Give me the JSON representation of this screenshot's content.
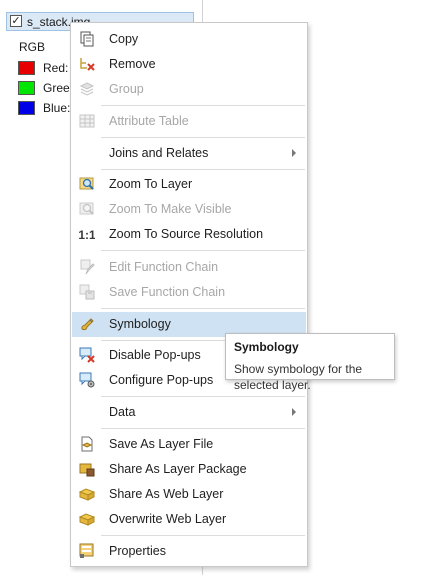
{
  "toc": {
    "layer_name": "s_stack.img",
    "checked": "✓",
    "renderer": "RGB",
    "bands": [
      {
        "label": "Red:",
        "color": "#e60000"
      },
      {
        "label": "Gree",
        "color": "#00e600"
      },
      {
        "label": "Blue:",
        "color": "#0000e6"
      }
    ]
  },
  "menu": {
    "items": [
      {
        "label": "Copy",
        "icon": "copy-icon",
        "enabled": true
      },
      {
        "label": "Remove",
        "icon": "remove-icon",
        "enabled": true
      },
      {
        "label": "Group",
        "icon": "group-icon",
        "enabled": false
      },
      {
        "label": "Attribute Table",
        "icon": "table-icon",
        "enabled": false
      },
      {
        "label": "Joins and Relates",
        "icon": "",
        "enabled": true,
        "submenu": true
      },
      {
        "label": "Zoom To Layer",
        "icon": "zoom-to-layer-icon",
        "enabled": true
      },
      {
        "label": "Zoom To Make Visible",
        "icon": "zoom-visible-icon",
        "enabled": false
      },
      {
        "label": "Zoom To Source Resolution",
        "icon": "one-to-one-icon",
        "icon_text": "1:1",
        "enabled": true
      },
      {
        "label": "Edit Function Chain",
        "icon": "edit-function-icon",
        "enabled": false
      },
      {
        "label": "Save Function Chain",
        "icon": "save-function-icon",
        "enabled": false
      },
      {
        "label": "Symbology",
        "icon": "symbology-icon",
        "enabled": true,
        "highlighted": true
      },
      {
        "label": "Disable Pop-ups",
        "icon": "disable-popups-icon",
        "enabled": true
      },
      {
        "label": "Configure Pop-ups",
        "icon": "configure-popups-icon",
        "enabled": true
      },
      {
        "label": "Data",
        "icon": "",
        "enabled": true,
        "submenu": true
      },
      {
        "label": "Save As Layer File",
        "icon": "layer-file-icon",
        "enabled": true
      },
      {
        "label": "Share As Layer Package",
        "icon": "layer-package-icon",
        "enabled": true
      },
      {
        "label": "Share As Web Layer",
        "icon": "web-layer-icon",
        "enabled": true
      },
      {
        "label": "Overwrite Web Layer",
        "icon": "overwrite-web-layer-icon",
        "enabled": true
      },
      {
        "label": "Properties",
        "icon": "properties-icon",
        "enabled": true
      }
    ]
  },
  "tooltip": {
    "title": "Symbology",
    "body": "Show symbology for the selected layer."
  }
}
